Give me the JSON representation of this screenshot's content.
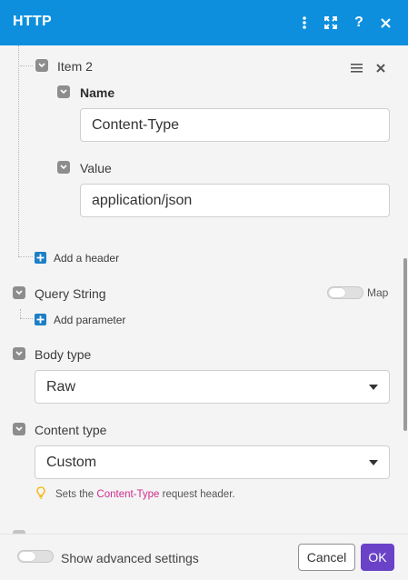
{
  "header": {
    "title": "HTTP",
    "icons": [
      "more-vertical-icon",
      "expand-icon",
      "help-icon",
      "close-icon"
    ]
  },
  "item": {
    "label": "Item 2",
    "name_label": "Name",
    "name_value": "Content-Type",
    "value_label": "Value",
    "value_value": "application/json"
  },
  "add_header_label": "Add a header",
  "query_string": {
    "label": "Query String",
    "map_label": "Map",
    "add_param_label": "Add parameter"
  },
  "body_type": {
    "label": "Body type",
    "selected": "Raw"
  },
  "content_type": {
    "label": "Content type",
    "selected": "Custom",
    "hint_prefix": "Sets the",
    "hint_code": "Content-Type",
    "hint_suffix": "request header."
  },
  "footer": {
    "advanced_label": "Show advanced settings",
    "cancel_label": "Cancel",
    "ok_label": "OK"
  },
  "colors": {
    "header_bg": "#0d8fde",
    "ok_bg": "#6a42c7",
    "plus_icon": "#1c7fc6",
    "hint_code": "#d02d8f"
  }
}
